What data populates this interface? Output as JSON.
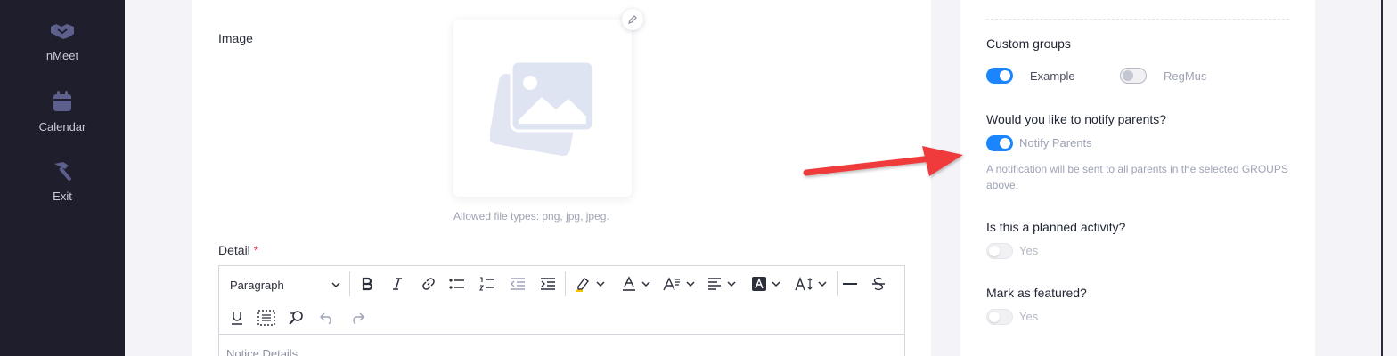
{
  "sidebar": {
    "items": [
      {
        "label": "nMeet",
        "icon": "handshake-icon"
      },
      {
        "label": "Calendar",
        "icon": "calendar-icon"
      },
      {
        "label": "Exit",
        "icon": "hammer-icon"
      }
    ]
  },
  "form": {
    "image_label": "Image",
    "file_hint": "Allowed file types: png, jpg, jpeg.",
    "detail_label": "Detail",
    "detail_required_mark": "*",
    "editor": {
      "block_format": "Paragraph",
      "placeholder": "Notice Details"
    }
  },
  "settings": {
    "custom_groups": {
      "title": "Custom groups",
      "options": [
        {
          "label": "Example",
          "enabled": true
        },
        {
          "label": "RegMus",
          "enabled": false
        }
      ]
    },
    "notify": {
      "title": "Would you like to notify parents?",
      "toggle_label": "Notify Parents",
      "enabled": true,
      "description": "A notification will be sent to all parents in the selected GROUPS above."
    },
    "planned": {
      "title": "Is this a planned activity?",
      "toggle_label": "Yes",
      "enabled": false
    },
    "featured": {
      "title": "Mark as featured?",
      "toggle_label": "Yes",
      "enabled": false
    }
  },
  "colors": {
    "accent": "#1b84ff",
    "sidebar_bg": "#1e1e2d",
    "annotation_arrow": "#ef3b3b"
  }
}
